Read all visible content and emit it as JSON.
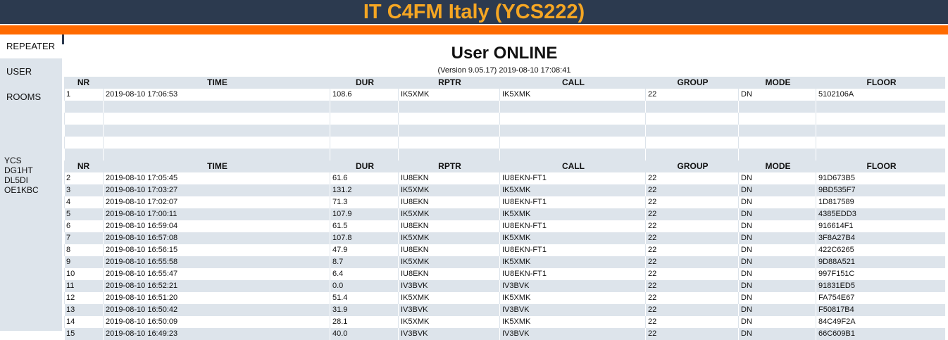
{
  "header": {
    "title": "IT C4FM Italy (YCS222)"
  },
  "sidebar": {
    "items": [
      {
        "label": "REPEATER"
      },
      {
        "label": "USER"
      },
      {
        "label": "ROOMS"
      }
    ],
    "rooms": [
      "YCS",
      "DG1HT",
      "DL5DI",
      "OE1KBC"
    ]
  },
  "main": {
    "title": "User ONLINE",
    "version": "(Version 9.05.17) 2019-08-10 17:08:41",
    "columns": [
      "NR",
      "TIME",
      "DUR",
      "RPTR",
      "CALL",
      "GROUP",
      "MODE",
      "FLOOR"
    ],
    "online": [
      [
        "1",
        "2019-08-10 17:06:53",
        "108.6",
        "IK5XMK",
        "IK5XMK",
        "22",
        "DN",
        "5102106A"
      ]
    ],
    "history": [
      [
        "2",
        "2019-08-10 17:05:45",
        "61.6",
        "IU8EKN",
        "IU8EKN-FT1",
        "22",
        "DN",
        "91D673B5"
      ],
      [
        "3",
        "2019-08-10 17:03:27",
        "131.2",
        "IK5XMK",
        "IK5XMK",
        "22",
        "DN",
        "9BD535F7"
      ],
      [
        "4",
        "2019-08-10 17:02:07",
        "71.3",
        "IU8EKN",
        "IU8EKN-FT1",
        "22",
        "DN",
        "1D817589"
      ],
      [
        "5",
        "2019-08-10 17:00:11",
        "107.9",
        "IK5XMK",
        "IK5XMK",
        "22",
        "DN",
        "4385EDD3"
      ],
      [
        "6",
        "2019-08-10 16:59:04",
        "61.5",
        "IU8EKN",
        "IU8EKN-FT1",
        "22",
        "DN",
        "916614F1"
      ],
      [
        "7",
        "2019-08-10 16:57:08",
        "107.8",
        "IK5XMK",
        "IK5XMK",
        "22",
        "DN",
        "3F8A27B4"
      ],
      [
        "8",
        "2019-08-10 16:56:15",
        "47.9",
        "IU8EKN",
        "IU8EKN-FT1",
        "22",
        "DN",
        "422C6265"
      ],
      [
        "9",
        "2019-08-10 16:55:58",
        "8.7",
        "IK5XMK",
        "IK5XMK",
        "22",
        "DN",
        "9D88A521"
      ],
      [
        "10",
        "2019-08-10 16:55:47",
        "6.4",
        "IU8EKN",
        "IU8EKN-FT1",
        "22",
        "DN",
        "997F151C"
      ],
      [
        "11",
        "2019-08-10 16:52:21",
        "0.0",
        "IV3BVK",
        "IV3BVK",
        "22",
        "DN",
        "91831ED5"
      ],
      [
        "12",
        "2019-08-10 16:51:20",
        "51.4",
        "IK5XMK",
        "IK5XMK",
        "22",
        "DN",
        "FA754E67"
      ],
      [
        "13",
        "2019-08-10 16:50:42",
        "31.9",
        "IV3BVK",
        "IV3BVK",
        "22",
        "DN",
        "F50817B4"
      ],
      [
        "14",
        "2019-08-10 16:50:09",
        "28.1",
        "IK5XMK",
        "IK5XMK",
        "22",
        "DN",
        "84C49F2A"
      ],
      [
        "15",
        "2019-08-10 16:49:23",
        "40.0",
        "IV3BVK",
        "IV3BVK",
        "22",
        "DN",
        "66C609B1"
      ]
    ]
  },
  "colors": {
    "topbar": "#2c3a4f",
    "title": "#f5a623",
    "accent_bar": "#ff6a00",
    "row_alt": "#dde4eb"
  }
}
